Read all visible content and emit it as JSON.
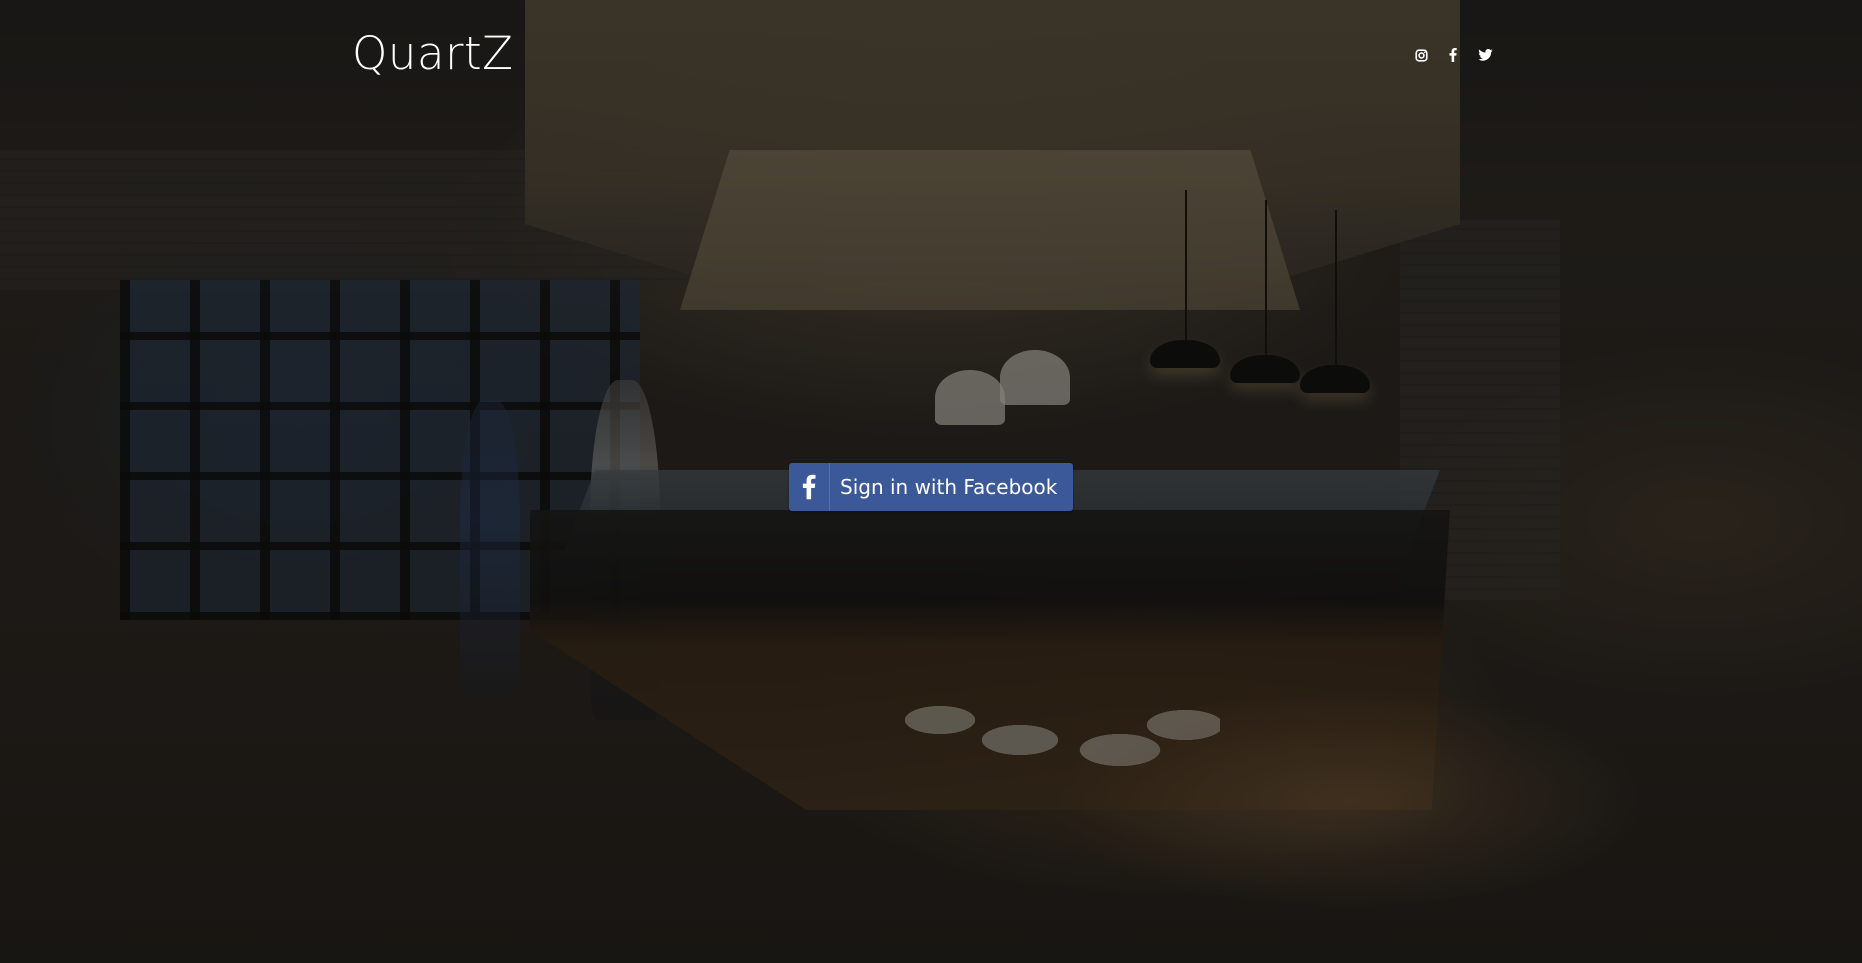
{
  "header": {
    "brand": "QuartZ",
    "social_links": [
      {
        "icon": "instagram-icon",
        "label": "Instagram"
      },
      {
        "icon": "facebook-icon",
        "label": "Facebook"
      },
      {
        "icon": "twitter-icon",
        "label": "Twitter"
      }
    ]
  },
  "main": {
    "login_button_label": "Sign in with Facebook",
    "login_button_icon": "facebook-f-icon"
  },
  "colors": {
    "facebook_blue": "#3b5998",
    "text": "#ffffff",
    "overlay": "rgba(12,10,8,0.45)"
  }
}
